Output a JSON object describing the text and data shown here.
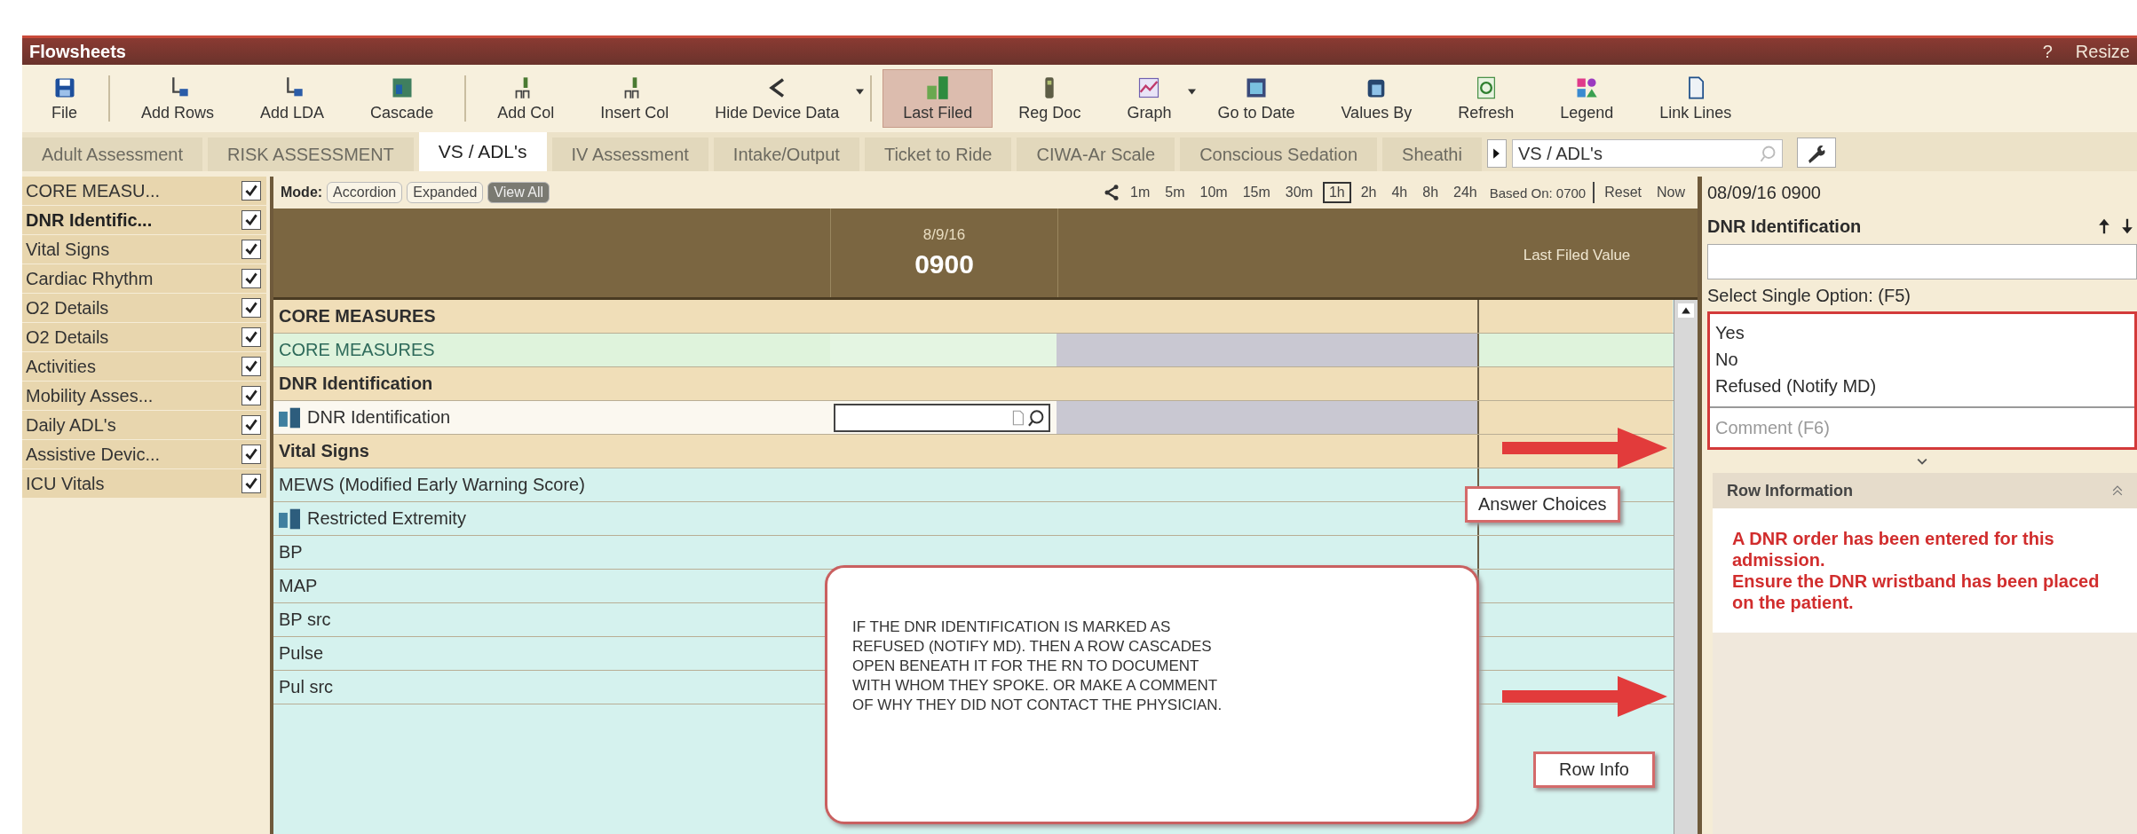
{
  "window": {
    "title": "Flowsheets",
    "help": "?",
    "resize": "Resize"
  },
  "toolbar": {
    "groups": [
      [
        {
          "label": "File",
          "selected": false,
          "dropdown": false
        }
      ],
      [
        {
          "label": "Add Rows",
          "selected": false,
          "dropdown": false
        },
        {
          "label": "Add LDA",
          "selected": false,
          "dropdown": false
        },
        {
          "label": "Cascade",
          "selected": false,
          "dropdown": false
        }
      ],
      [
        {
          "label": "Add Col",
          "selected": false,
          "dropdown": false
        },
        {
          "label": "Insert Col",
          "selected": false,
          "dropdown": false
        },
        {
          "label": "Hide Device Data",
          "selected": false,
          "dropdown": true
        }
      ],
      [
        {
          "label": "Last Filed",
          "selected": true,
          "dropdown": false
        },
        {
          "label": "Reg Doc",
          "selected": false,
          "dropdown": false
        },
        {
          "label": "Graph",
          "selected": false,
          "dropdown": true
        },
        {
          "label": "Go to Date",
          "selected": false,
          "dropdown": false
        },
        {
          "label": "Values By",
          "selected": false,
          "dropdown": false
        },
        {
          "label": "Refresh",
          "selected": false,
          "dropdown": false
        },
        {
          "label": "Legend",
          "selected": false,
          "dropdown": false
        },
        {
          "label": "Link Lines",
          "selected": false,
          "dropdown": false
        }
      ]
    ]
  },
  "tabs": [
    {
      "label": "Adult Assessment",
      "selected": false
    },
    {
      "label": "RISK ASSESSMENT",
      "selected": false
    },
    {
      "label": "VS / ADL's",
      "selected": true
    },
    {
      "label": "IV Assessment",
      "selected": false
    },
    {
      "label": "Intake/Output",
      "selected": false
    },
    {
      "label": "Ticket to Ride",
      "selected": false
    },
    {
      "label": "CIWA-Ar Scale",
      "selected": false
    },
    {
      "label": "Conscious Sedation",
      "selected": false
    },
    {
      "label": "Sheathi",
      "selected": false
    }
  ],
  "tab_search": {
    "value": "VS / ADL's"
  },
  "sidebar": {
    "items": [
      {
        "label": "CORE MEASU...",
        "checked": true,
        "selected": false
      },
      {
        "label": "DNR Identific...",
        "checked": true,
        "selected": true
      },
      {
        "label": "Vital Signs",
        "checked": true,
        "selected": false
      },
      {
        "label": "Cardiac Rhythm",
        "checked": true,
        "selected": false
      },
      {
        "label": "O2 Details",
        "checked": true,
        "selected": false
      },
      {
        "label": "O2 Details",
        "checked": true,
        "selected": false
      },
      {
        "label": "Activities",
        "checked": true,
        "selected": false
      },
      {
        "label": "Mobility Asses...",
        "checked": true,
        "selected": false
      },
      {
        "label": "Daily ADL's",
        "checked": true,
        "selected": false
      },
      {
        "label": "Assistive Devic...",
        "checked": true,
        "selected": false
      },
      {
        "label": "ICU Vitals",
        "checked": true,
        "selected": false
      }
    ]
  },
  "grid": {
    "mode": {
      "label": "Mode:",
      "options": [
        {
          "label": "Accordion",
          "selected": false
        },
        {
          "label": "Expanded",
          "selected": false
        },
        {
          "label": "View All",
          "selected": true
        }
      ]
    },
    "time_scale": {
      "options": [
        {
          "label": "1m",
          "selected": false
        },
        {
          "label": "5m",
          "selected": false
        },
        {
          "label": "10m",
          "selected": false
        },
        {
          "label": "15m",
          "selected": false
        },
        {
          "label": "30m",
          "selected": false
        },
        {
          "label": "1h",
          "selected": true
        },
        {
          "label": "2h",
          "selected": false
        },
        {
          "label": "4h",
          "selected": false
        },
        {
          "label": "8h",
          "selected": false
        },
        {
          "label": "24h",
          "selected": false
        }
      ],
      "based_on": "Based On: 0700",
      "reset": "Reset",
      "now": "Now"
    },
    "header": {
      "date": "8/9/16",
      "time": "0900",
      "last_filed": "Last Filed Value"
    },
    "rows": [
      {
        "kind": "section",
        "label": "CORE MEASURES",
        "cascade": false
      },
      {
        "kind": "core",
        "label": "CORE MEASURES",
        "cascade": false
      },
      {
        "kind": "section",
        "label": "DNR Identification",
        "cascade": false
      },
      {
        "kind": "input",
        "label": "DNR Identification",
        "cascade": true
      },
      {
        "kind": "section",
        "label": "Vital Signs",
        "cascade": false
      },
      {
        "kind": "vital",
        "label": "MEWS (Modified Early Warning Score)",
        "cascade": false
      },
      {
        "kind": "vital",
        "label": "Restricted Extremity",
        "cascade": true
      },
      {
        "kind": "vital",
        "label": "BP",
        "cascade": false
      },
      {
        "kind": "vital",
        "label": "MAP",
        "cascade": false
      },
      {
        "kind": "vital",
        "label": "BP  src",
        "cascade": false
      },
      {
        "kind": "vital",
        "label": "Pulse",
        "cascade": false
      },
      {
        "kind": "vital",
        "label": "Pul src",
        "cascade": false
      }
    ]
  },
  "right_panel": {
    "datetime": "08/09/16 0900",
    "row_title": "DNR Identification",
    "prompt": "Select Single Option: (F5)",
    "options": [
      {
        "label": "Yes",
        "selected": false
      },
      {
        "label": "No",
        "selected": false
      },
      {
        "label": "Refused (Notify MD)",
        "selected": false
      }
    ],
    "comment_placeholder": "Comment (F6)",
    "row_info": {
      "title": "Row Information",
      "message": "A DNR order has been entered for this admission.\nEnsure the DNR wristband has been placed on the patient."
    }
  },
  "annotations": {
    "note": "IF THE DNR IDENTIFICATION IS MARKED AS\nREFUSED (NOTIFY MD).  THEN A ROW CASCADES\nOPEN BENEATH IT FOR THE RN TO DOCUMENT\nWITH WHOM THEY SPOKE.  OR MAKE A COMMENT\nOF WHY THEY DID NOT CONTACT THE PHYSICIAN.",
    "labels": [
      "Answer Choices",
      "Row Info"
    ]
  }
}
